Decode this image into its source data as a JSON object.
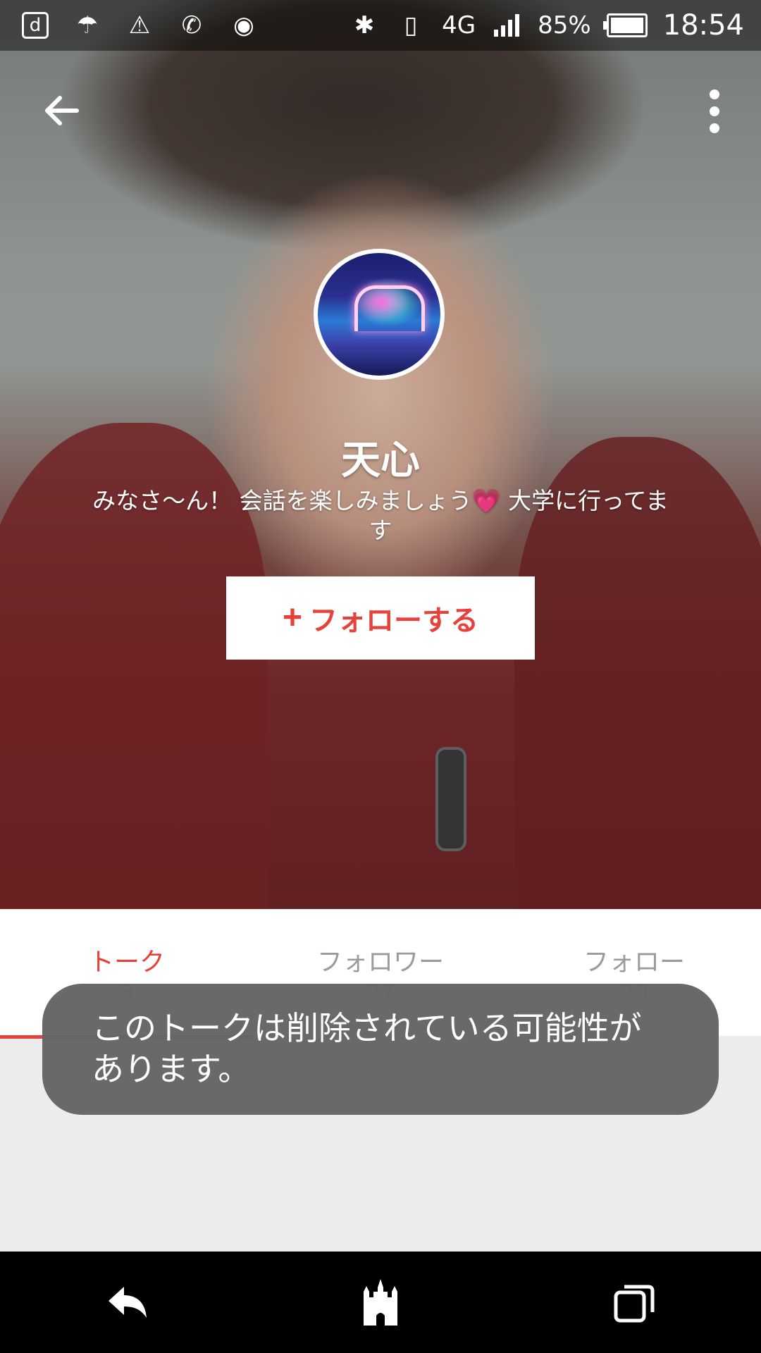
{
  "status_bar": {
    "icons_left": [
      "d-app-icon",
      "weather-icon",
      "warning-icon",
      "call-settings-icon",
      "disc-icon"
    ],
    "d_label": "d",
    "bluetooth": "bluetooth-icon",
    "network": "4G",
    "battery": "85%",
    "time": "18:54"
  },
  "app_bar": {
    "back_icon": "back-arrow-icon",
    "menu_icon": "more-vert-icon"
  },
  "profile": {
    "name": "天心",
    "bio": "みなさ〜ん！ 会話を楽しみましょう💗 大学に行ってます"
  },
  "follow_button": {
    "plus": "+",
    "label": "フォローする"
  },
  "tabs": [
    {
      "label": "トーク",
      "count": "3",
      "active": true
    },
    {
      "label": "フォロワー",
      "count": "27",
      "active": false
    },
    {
      "label": "フォロー",
      "count": "28",
      "active": false
    }
  ],
  "toast": {
    "message": "このトークは削除されている可能性があります。"
  },
  "nav_bar": {
    "buttons": [
      "back-icon",
      "home-castle-icon",
      "recents-icon"
    ]
  },
  "colors": {
    "accent": "#e8403a",
    "toast_bg": "#646464",
    "nav_bg": "#000000"
  }
}
